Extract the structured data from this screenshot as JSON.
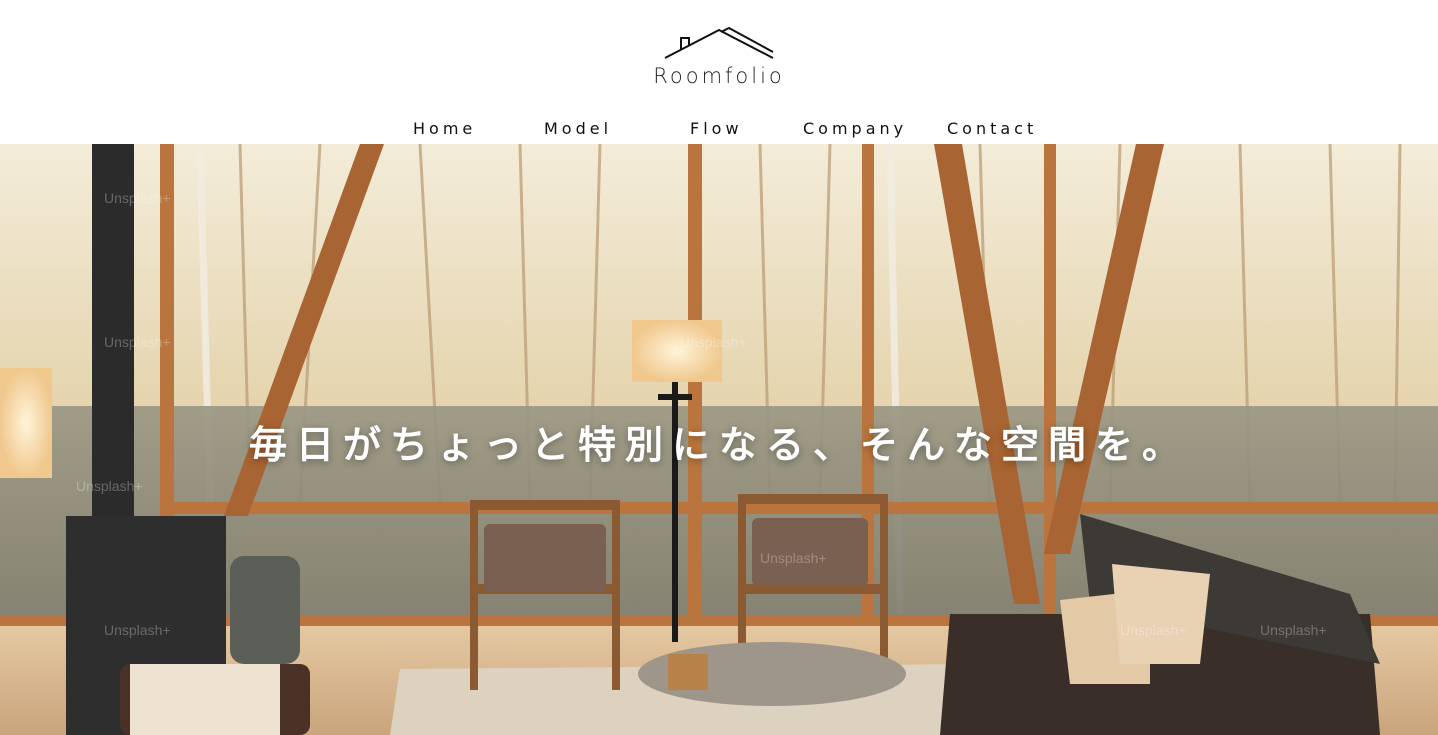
{
  "brand": {
    "name": "Roomfolio",
    "logo_icon": "house-roof-icon"
  },
  "nav": {
    "items": [
      {
        "label": "Home"
      },
      {
        "label": "Model"
      },
      {
        "label": "Flow"
      },
      {
        "label": "Company"
      },
      {
        "label": "Contact"
      }
    ]
  },
  "hero": {
    "tagline": "毎日がちょっと特別になる、そんな空間を。",
    "watermark": "Unsplash+",
    "image_subject": "living-room-photo"
  },
  "colors": {
    "text": "#111111",
    "background": "#ffffff",
    "tagline": "#ffffff"
  }
}
